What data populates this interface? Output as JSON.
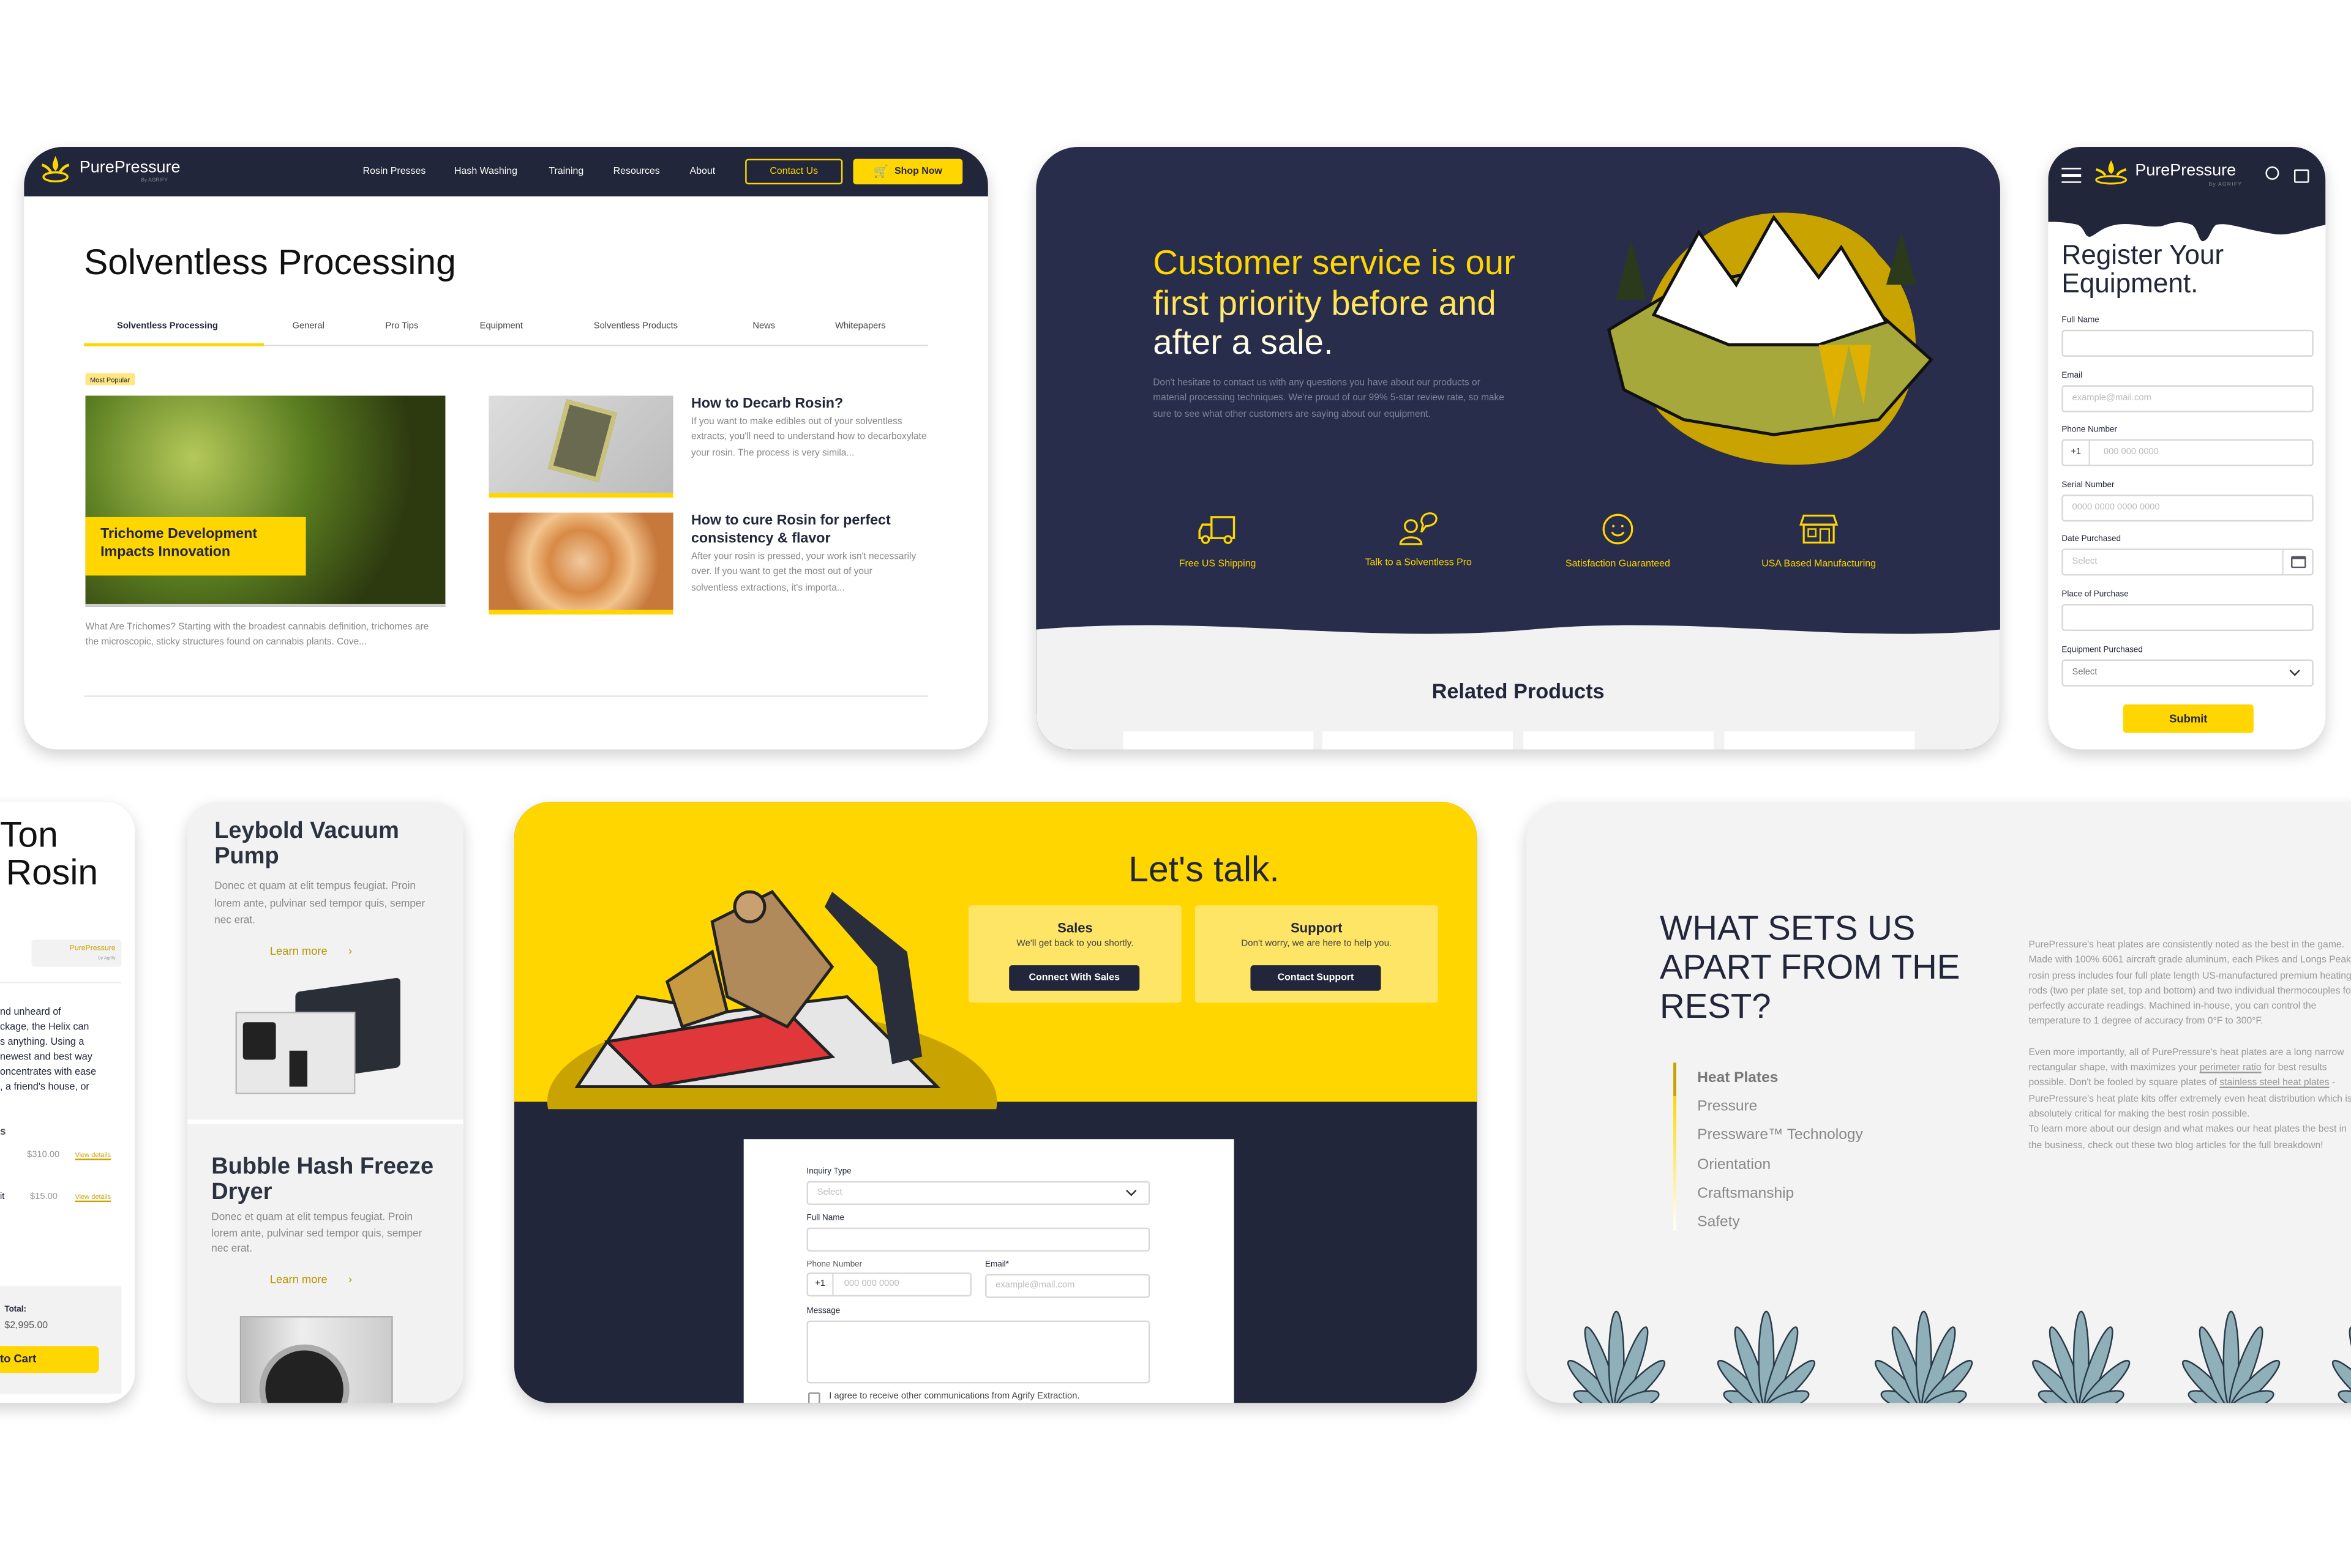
{
  "colors": {
    "navy": "#22263a",
    "yellow": "#ffd600",
    "panel_navy": "#272d4a",
    "light_gray": "#f2f2f2"
  },
  "blog": {
    "logo": {
      "name": "PurePressure",
      "sub": "By AGRIFY"
    },
    "nav": [
      "Rosin Presses",
      "Hash Washing",
      "Training",
      "Resources",
      "About"
    ],
    "contact_label": "Contact Us",
    "shop_label": "Shop Now",
    "title": "Solventless Processing",
    "tabs": [
      {
        "label": "Solventless Processing",
        "active": true
      },
      {
        "label": "General"
      },
      {
        "label": "Pro Tips"
      },
      {
        "label": "Equipment"
      },
      {
        "label": "Solventless Products"
      },
      {
        "label": "News"
      },
      {
        "label": "Whitepapers"
      }
    ],
    "badge": "Most Popular",
    "featured": {
      "caption": "Trichome Development Impacts Innovation",
      "excerpt": "What Are Trichomes? Starting with the broadest cannabis definition, trichomes are the microscopic, sticky structures found on cannabis plants. Cove..."
    },
    "articles": [
      {
        "title": "How to Decarb Rosin?",
        "excerpt": "If you want to make edibles out of your solventless extracts, you'll need to understand how to decarboxylate your rosin. The process is very simila..."
      },
      {
        "title": "How to cure Rosin for perfect consistency & flavor",
        "excerpt": "After your rosin is pressed, your work isn't necessarily over. If you want to get the most out of your solventless extractions, it's importa..."
      }
    ]
  },
  "service": {
    "headline": "Customer service is our first priority before and after a sale.",
    "body": "Don't hesitate to contact us with any questions you have about our products or material processing techniques. We're proud of our 99% 5-star review rate, so make sure to see what other customers are saying about our equipment.",
    "features": [
      {
        "icon": "truck-icon",
        "label": "Free US Shipping"
      },
      {
        "icon": "chat-person-icon",
        "label": "Talk to a Solventless Pro"
      },
      {
        "icon": "smiley-icon",
        "label": "Satisfaction Guaranteed"
      },
      {
        "icon": "storefront-icon",
        "label": "USA Based Manufacturing"
      }
    ],
    "related_title": "Related Products"
  },
  "register": {
    "logo": {
      "name": "PurePressure",
      "sub": "By AGRIFY"
    },
    "title": "Register Your Equipment.",
    "fields": {
      "full_name": {
        "label": "Full Name",
        "placeholder": ""
      },
      "email": {
        "label": "Email",
        "placeholder": "example@mail.com"
      },
      "phone": {
        "label": "Phone Number",
        "prefix": "+1",
        "placeholder": "000 000 0000"
      },
      "serial": {
        "label": "Serial Number",
        "placeholder": "0000 0000 0000 0000"
      },
      "date": {
        "label": "Date Purchased",
        "placeholder": "Select"
      },
      "place": {
        "label": "Place of Purchase",
        "placeholder": ""
      },
      "equipment": {
        "label": "Equipment Purchased",
        "value": "Select"
      }
    },
    "submit": "Submit"
  },
  "product": {
    "title_lines": [
      "Ton",
      "Rosin"
    ],
    "brand": {
      "name": "PurePressure",
      "sub": "by Agrify"
    },
    "desc_lines": [
      "nd unheard of",
      "ckage, the Helix can",
      "s anything. Using a",
      "newest and best way",
      "oncentrates with ease",
      ", a friend's house, or"
    ],
    "section_frag": "s",
    "addons": [
      {
        "frag": "",
        "price": "$310.00",
        "link": "View details"
      },
      {
        "frag": "it",
        "price": "$15.00",
        "link": "View details"
      }
    ],
    "total_label": "Total:",
    "total": "$2,995.00",
    "cart_label": "to Cart"
  },
  "accessories": [
    {
      "title": "Leybold Vacuum Pump",
      "desc": "Donec et quam at elit tempus feugiat. Proin lorem ante, pulvinar sed tempor quis, semper nec erat.",
      "link": "Learn more"
    },
    {
      "title": "Bubble Hash Freeze Dryer",
      "desc": "Donec et quam at elit tempus feugiat. Proin lorem ante, pulvinar sed tempor quis, semper nec erat.",
      "link": "Learn more"
    }
  ],
  "contact": {
    "title": "Let's talk.",
    "sales": {
      "title": "Sales",
      "text": "We'll get back to you shortly.",
      "button": "Connect With Sales"
    },
    "support": {
      "title": "Support",
      "text": "Don't worry, we are here to help you.",
      "button": "Contact Support"
    },
    "form": {
      "inquiry": {
        "label": "Inquiry Type",
        "value": "Select"
      },
      "full_name": {
        "label": "Full Name"
      },
      "phone": {
        "label": "Phone Number",
        "prefix": "+1",
        "placeholder": "000 000 0000"
      },
      "email": {
        "label": "Email*",
        "placeholder": "example@mail.com"
      },
      "message": {
        "label": "Message"
      },
      "consent": "I agree to receive other communications from Agrify Extraction."
    }
  },
  "features": {
    "title": "WHAT SETS US APART FROM THE REST?",
    "list": [
      {
        "label": "Heat Plates",
        "active": true
      },
      {
        "label": "Pressure"
      },
      {
        "label": "Pressware™ Technology"
      },
      {
        "label": "Orientation"
      },
      {
        "label": "Craftsmanship"
      },
      {
        "label": "Safety"
      }
    ],
    "para1": "PurePressure's heat plates are consistently noted as the best in the game. Made with 100% 6061 aircraft grade aluminum, each Pikes and Longs Peak rosin press includes four full plate length US-manufactured premium heating rods (two per plate set, top and bottom) and two individual thermocouples for perfectly accurate readings. Machined in-house, you can control the temperature to 1 degree of accuracy from 0°F to 300°F.",
    "para2_a": "Even more importantly, all of PurePressure's heat plates are a long narrow rectangular shape, with maximizes your ",
    "para2_link1": "perimeter ratio",
    "para2_b": " for best results possible. Don't be fooled by square plates of ",
    "para2_link2": "stainless steel heat plates",
    "para2_c": " - PurePressure's heat plate kits offer extremely even heat distribution which is absolutely critical for making the best rosin possible.",
    "para3": "To learn more about our design and what makes our heat plates the best in the business, check out these two blog articles for the full breakdown!"
  }
}
